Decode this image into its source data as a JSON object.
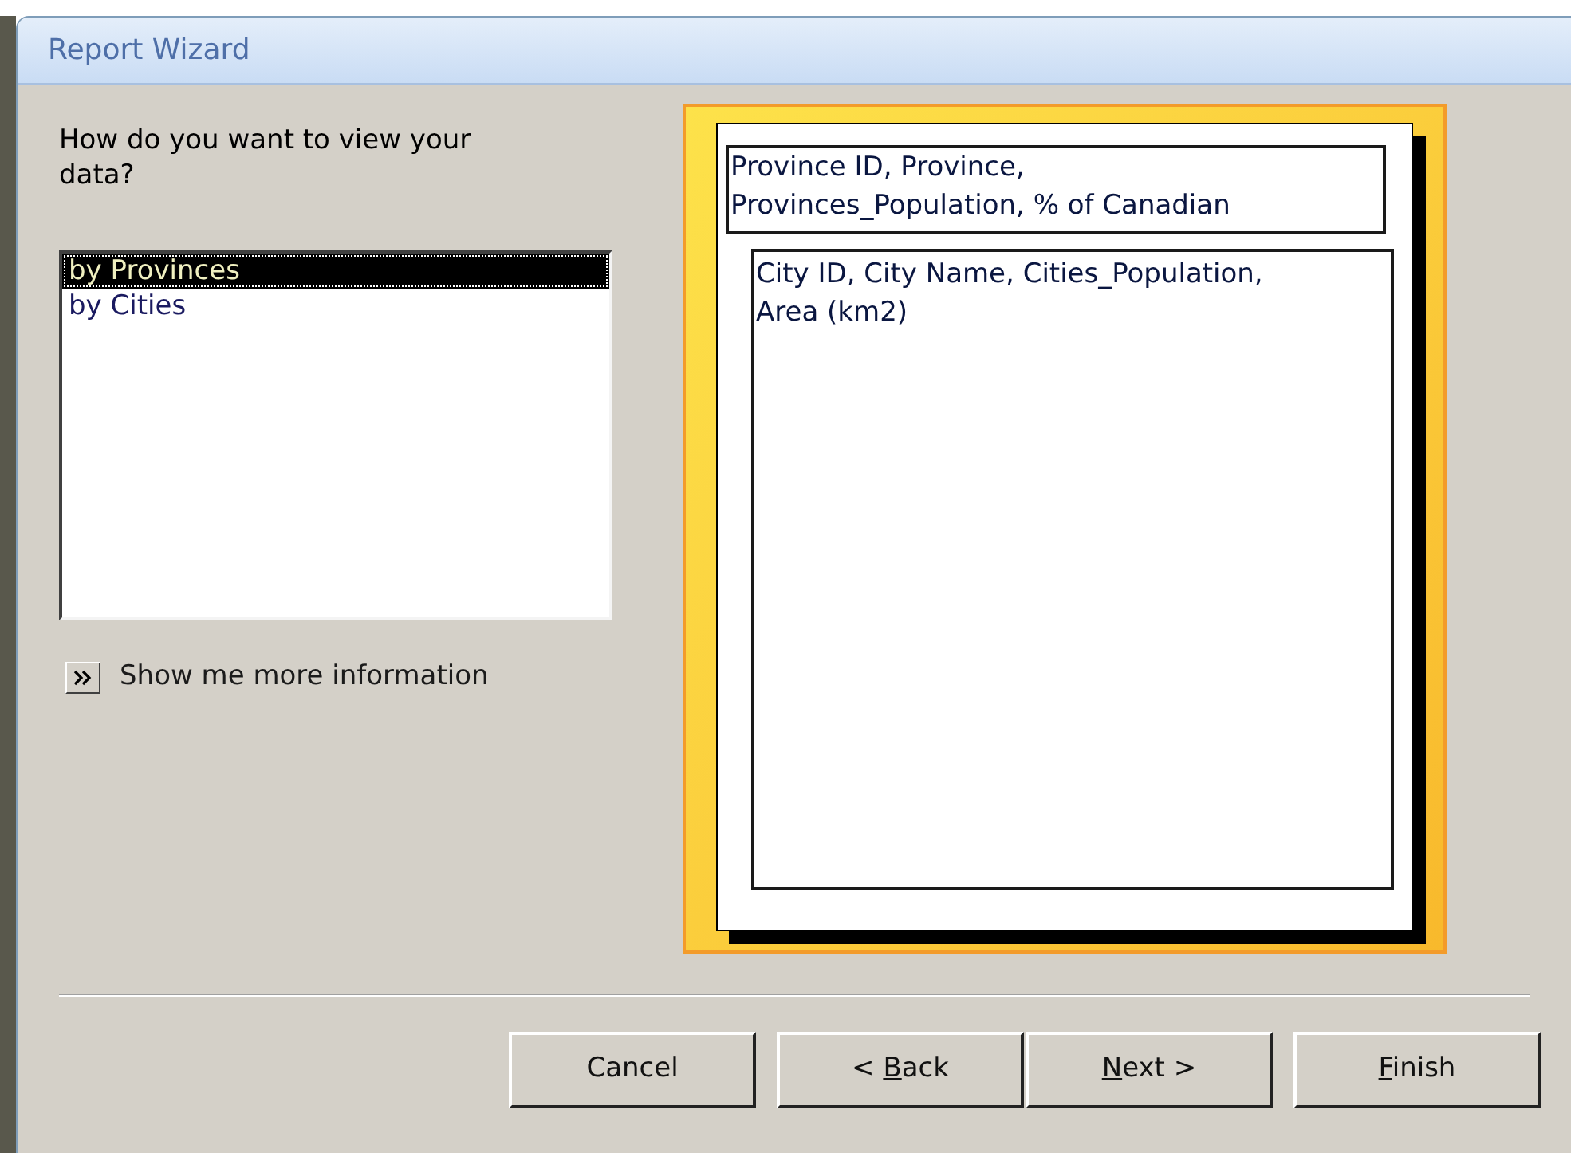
{
  "window": {
    "title": "Report Wizard"
  },
  "prompt": "How do you want to view your data?",
  "view_list": [
    {
      "label": "by Provinces",
      "selected": true
    },
    {
      "label": "by Cities",
      "selected": false
    }
  ],
  "more_info": {
    "label": "Show me more information"
  },
  "preview": {
    "header_fields": "Province ID, Province, Provinces_Population, % of Canadian",
    "detail_fields": "City ID, City Name, Cities_Population, Area (km2)"
  },
  "buttons": [
    {
      "pre": "Cancel"
    },
    {
      "pre": "< ",
      "key": "B",
      "post": "ack"
    },
    {
      "key": "N",
      "post": "ext >"
    },
    {
      "key": "F",
      "post": "inish"
    }
  ]
}
